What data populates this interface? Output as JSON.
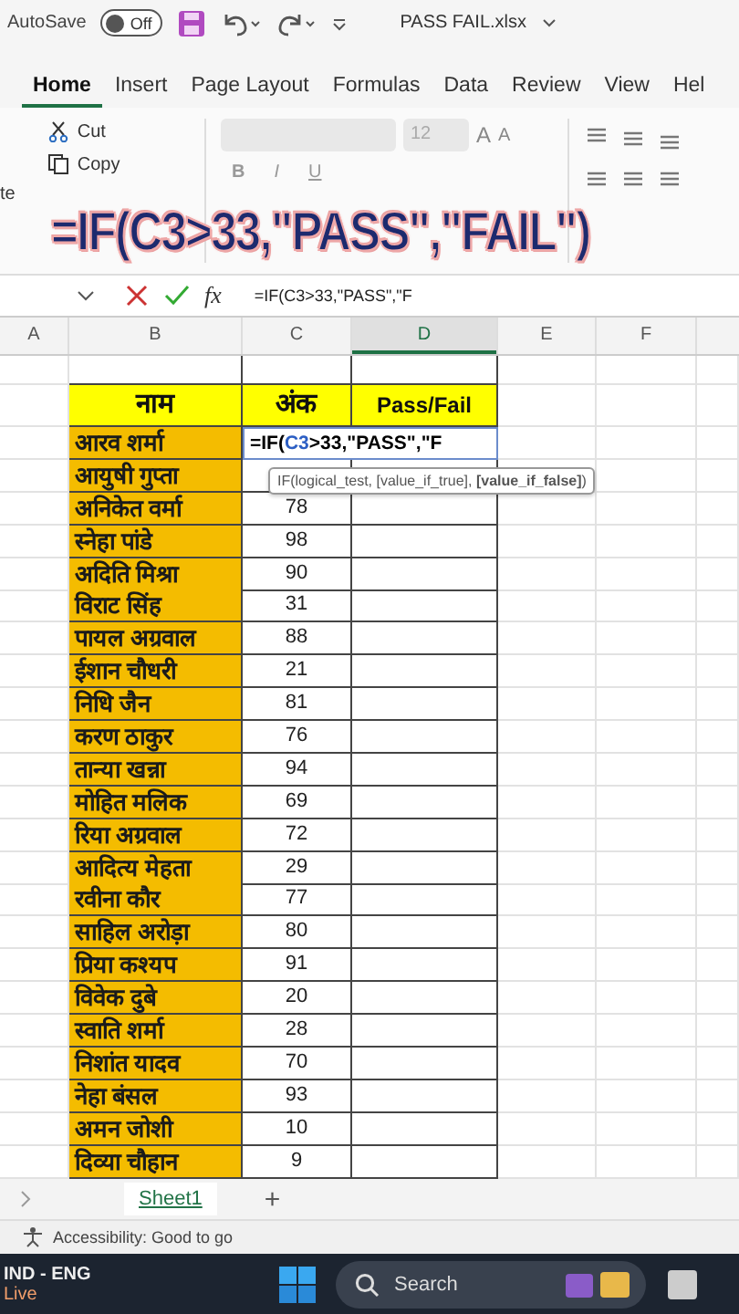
{
  "title_bar": {
    "autosave_label": "AutoSave",
    "autosave_on": false,
    "toggle_text": "Off",
    "file_name": "PASS FAIL.xlsx"
  },
  "ribbon_tabs": [
    {
      "label": "Home",
      "selected": true
    },
    {
      "label": "Insert",
      "selected": false
    },
    {
      "label": "Page Layout",
      "selected": false
    },
    {
      "label": "Formulas",
      "selected": false
    },
    {
      "label": "Data",
      "selected": false
    },
    {
      "label": "Review",
      "selected": false
    },
    {
      "label": "View",
      "selected": false
    },
    {
      "label": "Hel",
      "selected": false
    }
  ],
  "ribbon": {
    "paste_label": "te",
    "cut": "Cut",
    "copy": "Copy",
    "font_size": "12",
    "grow_font": "A",
    "shrink_font": "A",
    "bold": "B",
    "italic": "I",
    "underline": "U"
  },
  "caption": "=IF(C3>33,\"PASS\",\"FAIL\")",
  "formula_bar": {
    "fx": "fx",
    "formula": "=IF(C3>33,\"PASS\",\"F"
  },
  "columns": [
    "A",
    "B",
    "C",
    "D",
    "E",
    "F"
  ],
  "header_row": [
    "नाम",
    "अंक",
    "Pass/Fail"
  ],
  "editing": {
    "before": "=IF(",
    "ref": "C3",
    "after": ">33,\"PASS\",\"F"
  },
  "tooltip": "IF(logical_test, [value_if_true], **[value_if_false]**)",
  "rows": [
    {
      "name": "आरव शर्मा",
      "score": ""
    },
    {
      "name": "आयुषी गुप्ता",
      "score": ""
    },
    {
      "name": "अनिकेत वर्मा",
      "score": "78"
    },
    {
      "name": "स्नेहा पांडे",
      "score": "98"
    },
    {
      "name": "अदिति मिश्रा",
      "score": "90"
    },
    {
      "name": "विराट सिंह",
      "score": "31"
    },
    {
      "name": "पायल अग्रवाल",
      "score": "88"
    },
    {
      "name": "ईशान चौधरी",
      "score": "21"
    },
    {
      "name": "निधि जैन",
      "score": "81"
    },
    {
      "name": "करण ठाकुर",
      "score": "76"
    },
    {
      "name": "तान्या खन्ना",
      "score": "94"
    },
    {
      "name": "मोहित मलिक",
      "score": "69"
    },
    {
      "name": "रिया अग्रवाल",
      "score": "72"
    },
    {
      "name": "आदित्य मेहता",
      "score": "29"
    },
    {
      "name": "रवीना कौर",
      "score": "77"
    },
    {
      "name": "साहिल अरोड़ा",
      "score": "80"
    },
    {
      "name": "प्रिया कश्यप",
      "score": "91"
    },
    {
      "name": "विवेक दुबे",
      "score": "20"
    },
    {
      "name": "स्वाति शर्मा",
      "score": "28"
    },
    {
      "name": "निशांत यादव",
      "score": "70"
    },
    {
      "name": "नेहा बंसल",
      "score": "93"
    },
    {
      "name": "अमन जोशी",
      "score": "10"
    },
    {
      "name": "दिव्या चौहान",
      "score": "9"
    }
  ],
  "sheet_tabs": [
    {
      "label": "Sheet1",
      "selected": true
    }
  ],
  "add_sheet": "+",
  "status": "Accessibility: Good to go",
  "taskbar": {
    "language": "IND - ENG",
    "live": "Live",
    "search": "Search"
  }
}
